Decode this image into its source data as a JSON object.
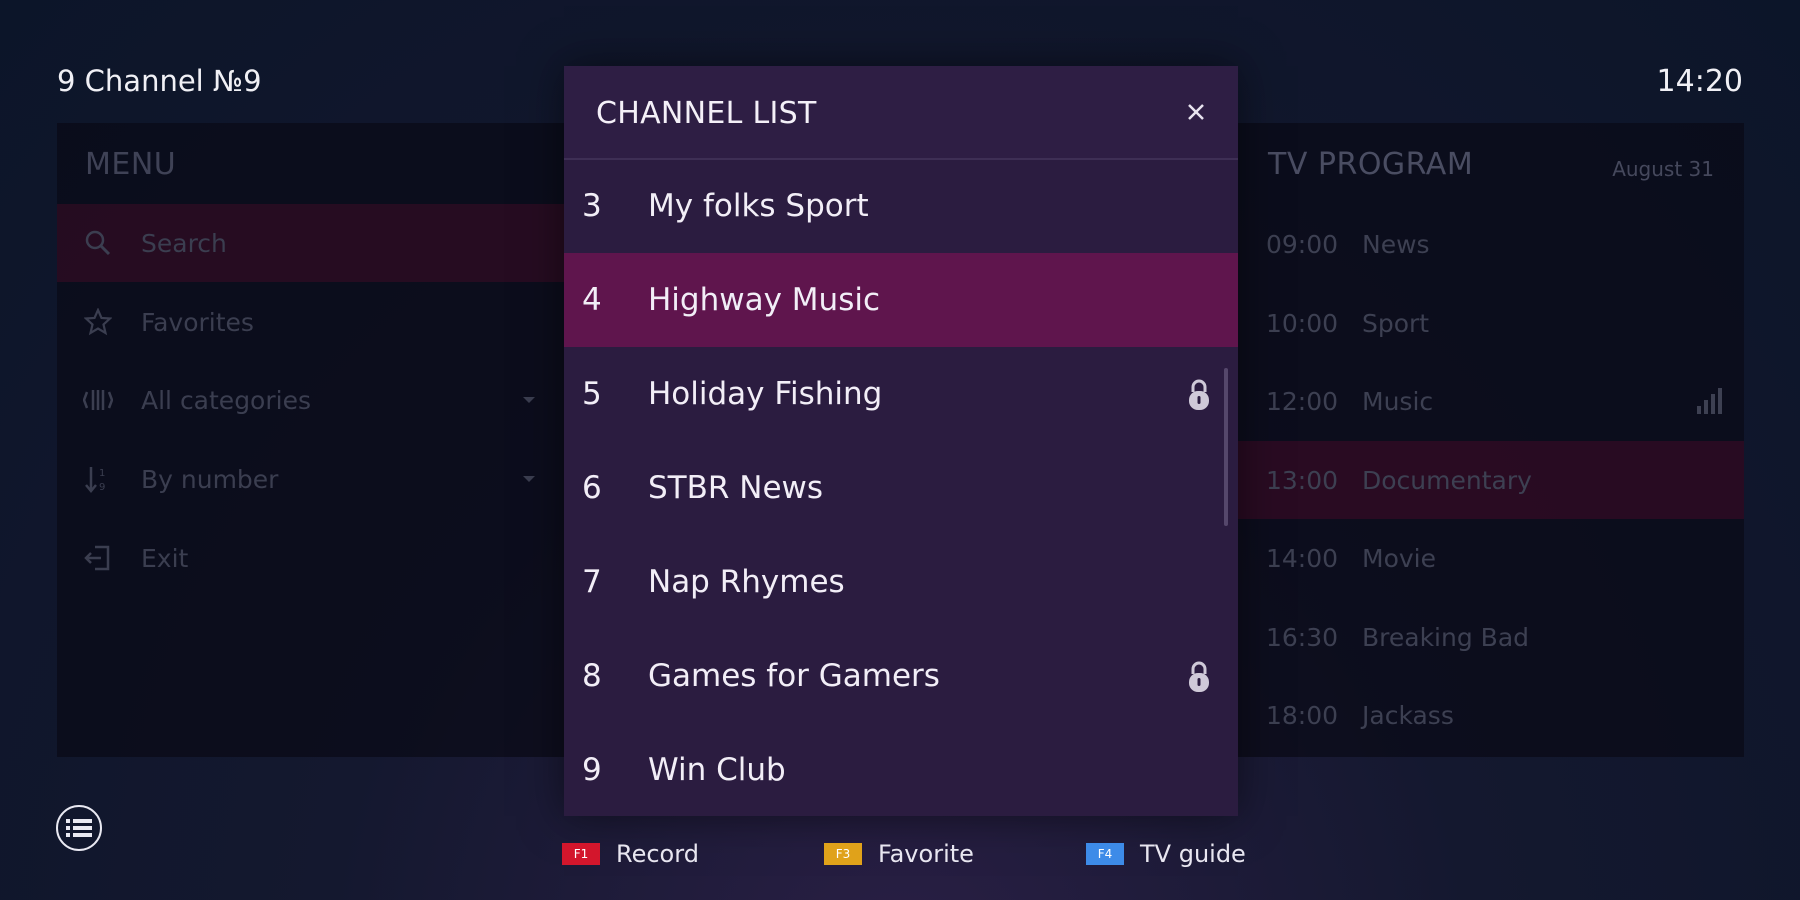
{
  "header": {
    "channel_title": "9 Channel №9",
    "clock": "14:20"
  },
  "menu": {
    "title": "MENU",
    "items": [
      {
        "label": "Search",
        "icon": "search-icon",
        "active": true
      },
      {
        "label": "Favorites",
        "icon": "star-icon"
      },
      {
        "label": "All categories",
        "icon": "categories-icon",
        "dropdown": true
      },
      {
        "label": "By number",
        "icon": "sort-icon",
        "dropdown": true
      },
      {
        "label": "Exit",
        "icon": "exit-icon"
      }
    ]
  },
  "program": {
    "title": "TV PROGRAM",
    "date": "August 31",
    "items": [
      {
        "time": "09:00",
        "name": "News"
      },
      {
        "time": "10:00",
        "name": "Sport"
      },
      {
        "time": "12:00",
        "name": "Music",
        "indicator": "signal-bars-icon"
      },
      {
        "time": "13:00",
        "name": "Documentary",
        "active": true
      },
      {
        "time": "14:00",
        "name": "Movie"
      },
      {
        "time": "16:30",
        "name": "Breaking Bad"
      },
      {
        "time": "18:00",
        "name": "Jackass"
      }
    ]
  },
  "channel_list": {
    "title": "CHANNEL LIST",
    "close_icon": "close-icon",
    "channels": [
      {
        "number": "3",
        "name": "My folks Sport"
      },
      {
        "number": "4",
        "name": "Highway Music",
        "active": true
      },
      {
        "number": "5",
        "name": "Holiday Fishing",
        "locked": true
      },
      {
        "number": "6",
        "name": "STBR News"
      },
      {
        "number": "7",
        "name": "Nap Rhymes"
      },
      {
        "number": "8",
        "name": "Games for Gamers",
        "locked": true
      },
      {
        "number": "9",
        "name": "Win Club"
      }
    ]
  },
  "footer": {
    "list_icon": "list-icon",
    "hints": [
      {
        "key": "F1",
        "label": "Record",
        "color": "#d3162c"
      },
      {
        "key": "F3",
        "label": "Favorite",
        "color": "#e0a21a"
      },
      {
        "key": "F4",
        "label": "TV guide",
        "color": "#3d8be8"
      }
    ]
  },
  "colors": {
    "accent": "#5f154d",
    "modal_bg": "#2b1c40",
    "background": "#0c1529"
  }
}
